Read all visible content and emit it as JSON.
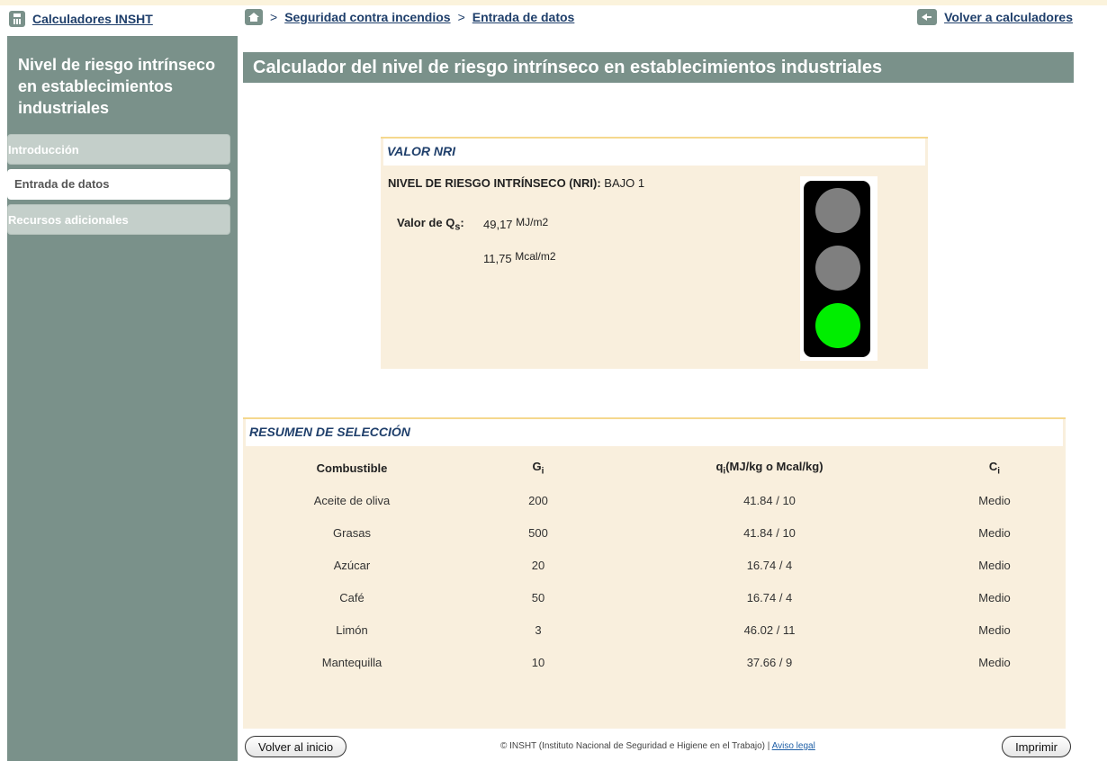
{
  "top": {
    "calculators_link": "Calculadores INSHT",
    "breadcrumb_sep1": ">",
    "breadcrumb_1": "Seguridad contra incendios",
    "breadcrumb_sep2": ">",
    "breadcrumb_2": "Entrada de datos",
    "back_link": "Volver a calculadores"
  },
  "sidebar": {
    "title": "Nivel de riesgo intrínseco en establecimientos industriales",
    "items": [
      {
        "label": "Introducción",
        "state": "inactive"
      },
      {
        "label": "Entrada de datos",
        "state": "active"
      },
      {
        "label": "Recursos adicionales",
        "state": "inactive"
      }
    ]
  },
  "main": {
    "title": "Calculador del nivel de riesgo intrínseco en establecimientos industriales"
  },
  "nri": {
    "header": "VALOR NRI",
    "label": "NIVEL DE RIESGO INTRÍNSECO (NRI):",
    "value": "BAJO 1",
    "qs_label": "Valor de Q",
    "qs_sub": "s",
    "qs_colon": ":",
    "qs_value_1": "49,17",
    "qs_unit_1": "MJ/m2",
    "qs_value_2": "11,75",
    "qs_unit_2": "Mcal/m2",
    "traffic_light": {
      "red": "off",
      "yellow": "off",
      "green": "on",
      "on_color": "#00ee00",
      "off_color": "#7f7f7f"
    }
  },
  "summary": {
    "header": "RESUMEN DE SELECCIÓN",
    "columns": {
      "combustible": "Combustible",
      "g": "G",
      "g_sub": "i",
      "q": "q",
      "q_sub": "i",
      "q_rest": "(MJ/kg o Mcal/kg)",
      "c": "C",
      "c_sub": "i"
    },
    "rows": [
      {
        "combustible": "Aceite de oliva",
        "g": "200",
        "q": "41.84 / 10",
        "c": "Medio"
      },
      {
        "combustible": "Grasas",
        "g": "500",
        "q": "41.84 / 10",
        "c": "Medio"
      },
      {
        "combustible": "Azúcar",
        "g": "20",
        "q": "16.74 / 4",
        "c": "Medio"
      },
      {
        "combustible": "Café",
        "g": "50",
        "q": "16.74 / 4",
        "c": "Medio"
      },
      {
        "combustible": "Limón",
        "g": "3",
        "q": "46.02 / 11",
        "c": "Medio"
      },
      {
        "combustible": "Mantequilla",
        "g": "10",
        "q": "37.66 / 9",
        "c": "Medio"
      }
    ]
  },
  "footer": {
    "home_button": "Volver al inicio",
    "copyright": "© INSHT (Instituto Nacional de Seguridad e Higiene en el Trabajo) |",
    "legal_link": "Aviso legal",
    "print_button": "Imprimir"
  },
  "colors": {
    "accent": "#7a918a",
    "panel": "#f9efdd",
    "link": "#1f3f6b"
  }
}
